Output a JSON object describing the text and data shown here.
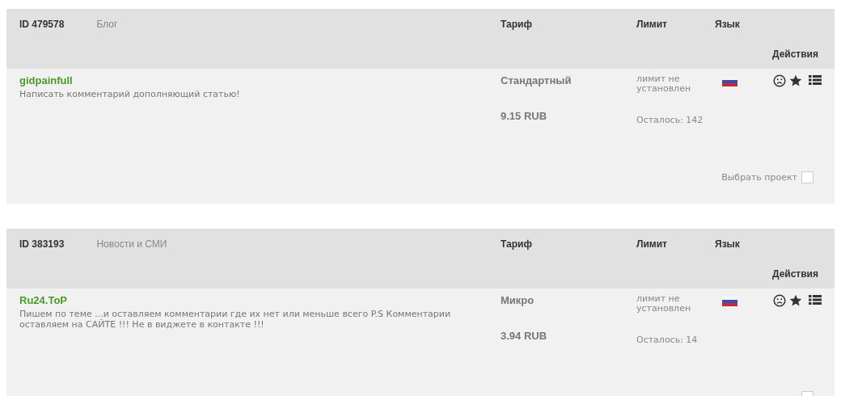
{
  "projects": [
    {
      "header": {
        "id": "ID 479578",
        "category": "Блог",
        "tariff": "Тариф",
        "limit": "Лимит",
        "language": "Язык",
        "actions": "Действия"
      },
      "name": "gidpainfull",
      "description": "Написать комментарий дополняющий статью!",
      "tariff": "Стандартный",
      "price": "9.15 RUB",
      "limit": "лимит не установлен",
      "remaining": "Осталось: 142",
      "select": {
        "label": "Выбрать проект",
        "checked": false
      }
    },
    {
      "header": {
        "id": "ID 383193",
        "category": "Новости и СМИ",
        "tariff": "Тариф",
        "limit": "Лимит",
        "language": "Язык",
        "actions": "Действия"
      },
      "name": "Ru24.ToP",
      "description": "Пишем по теме ...и оставляем комментарии где их нет или меньше всего P.S Комментарии оставляем на САЙТЕ !!! Не в виджете в контакте !!!",
      "tariff": "Микро",
      "price": "3.94 RUB",
      "limit": "лимит не установлен",
      "remaining": "Осталось: 14",
      "select": {
        "checked": false
      }
    }
  ]
}
